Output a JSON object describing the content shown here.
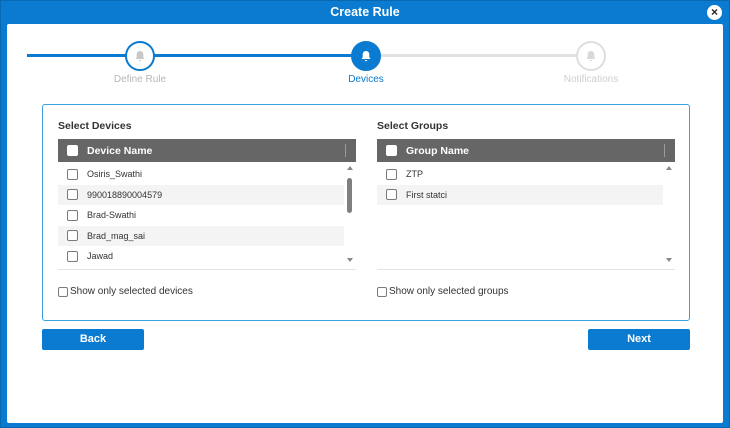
{
  "window": {
    "title": "Create Rule",
    "close_glyph": "×"
  },
  "stepper": {
    "steps": [
      {
        "label": "Define Rule",
        "icon": "bell-icon",
        "state": "completed"
      },
      {
        "label": "Devices",
        "icon": "bell-icon",
        "state": "active"
      },
      {
        "label": "Notifications",
        "icon": "bell-icon",
        "state": "pending"
      }
    ]
  },
  "devices": {
    "title": "Select Devices",
    "column_header": "Device Name",
    "rows": [
      "Osiris_Swathi",
      "990018890004579",
      "Brad-Swathi",
      "Brad_mag_sai",
      "Jawad"
    ],
    "show_only_label": "Show only selected devices"
  },
  "groups": {
    "title": "Select Groups",
    "column_header": "Group Name",
    "rows": [
      "ZTP",
      "First statci"
    ],
    "show_only_label": "Show only selected groups"
  },
  "buttons": {
    "back": "Back",
    "next": "Next"
  },
  "colors": {
    "accent": "#0a7bd0",
    "header": "#666666",
    "inactive": "#dedede"
  }
}
